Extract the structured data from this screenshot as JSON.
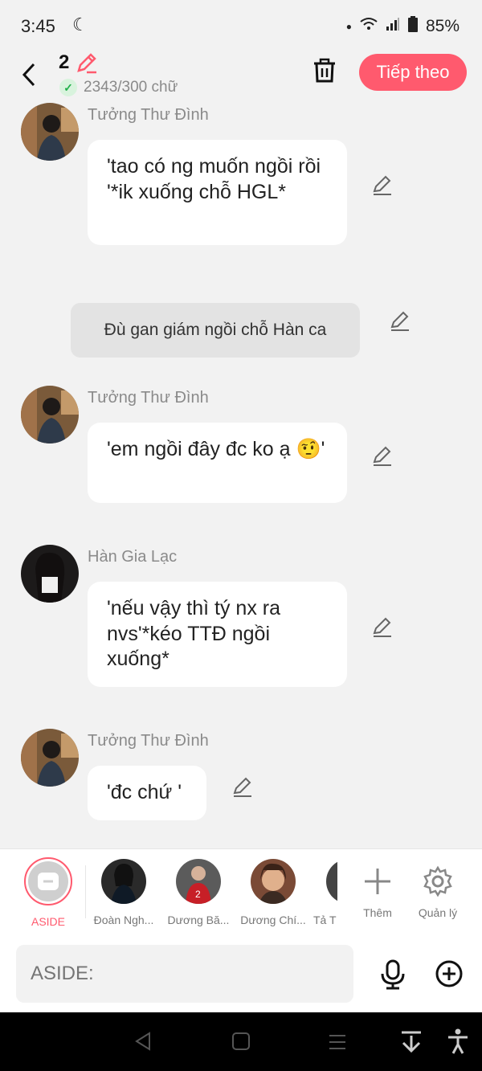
{
  "status": {
    "time": "3:45",
    "battery": "85%"
  },
  "header": {
    "draft_number": "2",
    "word_count": "2343/300 chữ",
    "next_label": "Tiếp theo"
  },
  "messages": [
    {
      "name": "Tưởng Thư Đình",
      "text": "'tao có ng muốn ngồi rồi '*ik xuống chỗ HGL*"
    },
    {
      "aside": "Đù gan giám ngồi chỗ Hàn ca"
    },
    {
      "name": "Tưởng Thư Đình",
      "text": "'em ngồi đây đc ko ạ 🤨'"
    },
    {
      "name": "Hàn Gia Lạc",
      "text": "'nếu vậy thì tý nx ra nvs'*kéo TTĐ ngồi xuống*"
    },
    {
      "name": "Tưởng Thư Đình",
      "text": "'đc chứ '"
    }
  ],
  "characters": [
    {
      "label": "ASIDE"
    },
    {
      "label": "Đoàn Ngh..."
    },
    {
      "label": "Dương Bă..."
    },
    {
      "label": "Dương Chí..."
    },
    {
      "label": "Tả T"
    }
  ],
  "actions": {
    "add_label": "Thêm",
    "manage_label": "Quản lý"
  },
  "input": {
    "placeholder": "ASIDE:"
  },
  "colors": {
    "accent": "#ff5a6e",
    "bubble": "#ffffff",
    "background": "#f2f2f2"
  }
}
